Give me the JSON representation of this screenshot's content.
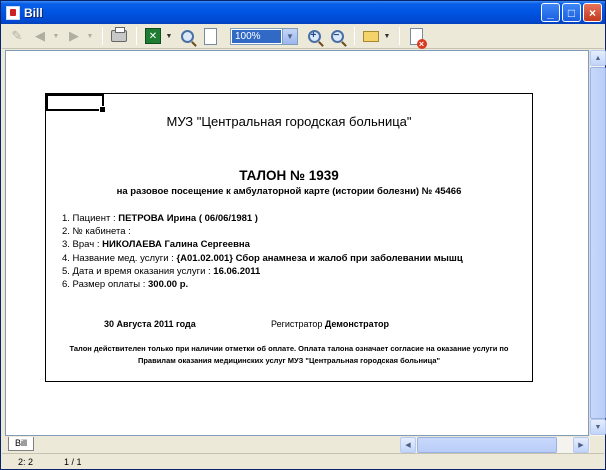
{
  "window": {
    "title": "Bill"
  },
  "toolbar": {
    "zoom_value": "100%"
  },
  "document": {
    "organization": "МУЗ \"Центральная городская больница\"",
    "ticket_title": "ТАЛОН № 1939",
    "subtitle": "на разовое посещение к амбулаторной карте (истории болезни) №  45466",
    "lines": [
      {
        "label": "1. Пациент : ",
        "value": "ПЕТРОВА Ирина  ( 06/06/1981 )"
      },
      {
        "label": "2. № кабинета :",
        "value": ""
      },
      {
        "label": "3. Врач : ",
        "value": "НИКОЛАЕВА Галина Сергеевна"
      },
      {
        "label": "4. Название мед. услуги : ",
        "value": "{А01.02.001} Сбор анамнеза и жалоб при заболевании мышц"
      },
      {
        "label": "5. Дата и время оказания услуги : ",
        "value": "16.06.2011"
      },
      {
        "label": "6. Размер оплаты : ",
        "value": "300.00 р."
      }
    ],
    "date": "30 Августа 2011 года",
    "registrar_label": "Регистратор ",
    "registrar_name": "Демонстратор",
    "notice_line1": "Талон действителен только при наличии отметки об оплате. Оплата талона означает согласие на оказание услуги по",
    "notice_line2": "Правилам оказания медицинских услуг МУЗ \"Центральная городская больница\""
  },
  "sheet_tab": "Bill",
  "status": {
    "cell": "2: 2",
    "page": "1 / 1"
  }
}
